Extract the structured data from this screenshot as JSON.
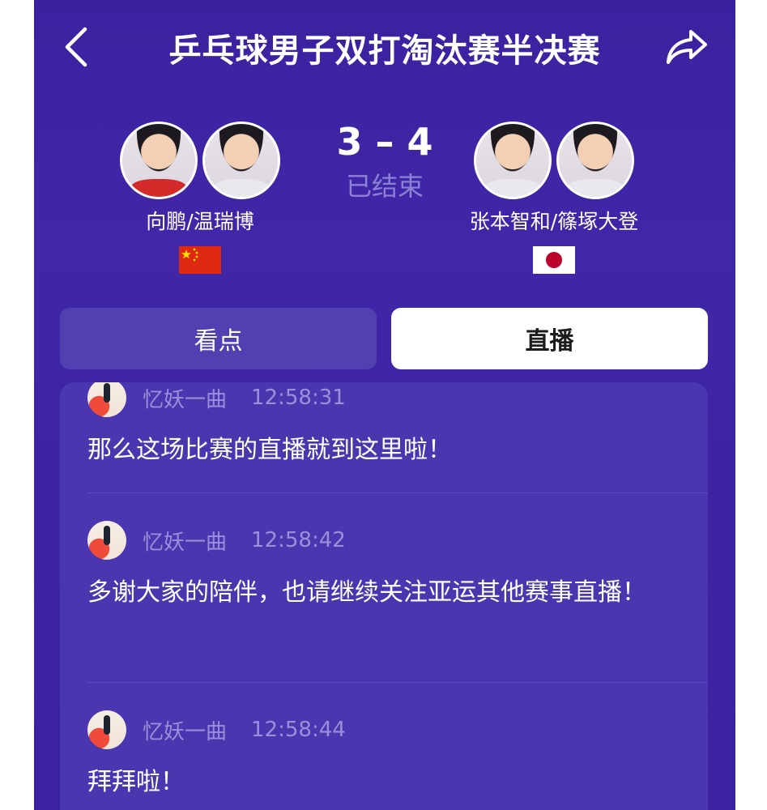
{
  "header": {
    "title": "乒乓球男子双打淘汰赛半决赛",
    "back_icon": "chevron-left-icon",
    "share_icon": "share-arrow-icon"
  },
  "match": {
    "score": "3 – 4",
    "status": "已结束",
    "team_left": {
      "name": "向鹏/温瑞博",
      "flag": "china-flag"
    },
    "team_right": {
      "name": "张本智和/篠塚大登",
      "flag": "japan-flag"
    }
  },
  "tabs": [
    {
      "label": "看点",
      "active": false
    },
    {
      "label": "直播",
      "active": true
    }
  ],
  "feed": {
    "entries": [
      {
        "nickname": "忆妖一曲",
        "time": "12:58:31",
        "message": "那么这场比赛的直播就到这里啦！"
      },
      {
        "nickname": "忆妖一曲",
        "time": "12:58:42",
        "message": "多谢大家的陪伴，也请继续关注亚运其他赛事直播！"
      },
      {
        "nickname": "忆妖一曲",
        "time": "12:58:44",
        "message": "拜拜啦！"
      }
    ]
  },
  "colors": {
    "background": "#3c24a3",
    "card": "#4a37af",
    "accent_text": "#9a8fd8",
    "active_tab": "#ffffff"
  }
}
